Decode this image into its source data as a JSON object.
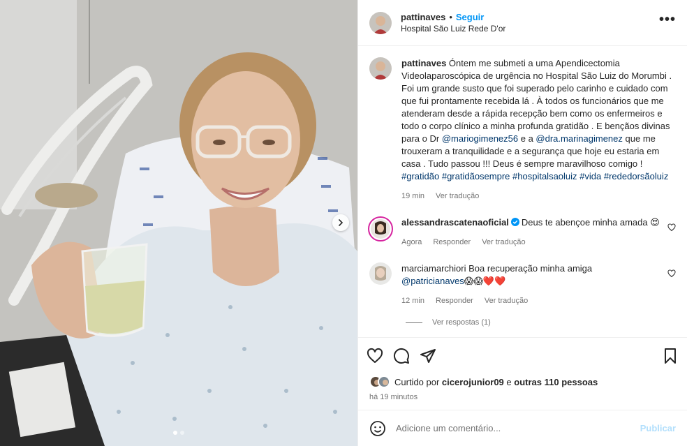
{
  "header": {
    "username": "pattinaves",
    "separator": "•",
    "follow_label": "Seguir",
    "location": "Hospital São Luiz Rede D'or",
    "more_label": "•••"
  },
  "caption": {
    "username": "pattinaves",
    "text_1": " Óntem me submeti a uma Apendicectomia Videolaparoscópica de urgência no Hospital São Luiz do Morumbi . Foi um grande susto que foi superado pelo carinho e cuidado com que fui prontamente recebida lá . À todos os funcionários que me atenderam desde a rápida recepção bem como os enfermeiros e todo o corpo clínico a minha profunda gratidão . E bençãos divinas para o Dr ",
    "mention_1": "@mariogimenez56",
    "text_2": " e a ",
    "mention_2": "@dra.marinagimenez",
    "text_3": " que me trouxeram a tranquilidade e a segurança que hoje eu estaria em casa . Tudo passou !!! Deus é sempre maravilhoso comigo ! ",
    "hashtags": [
      "#gratidão",
      "#gratidãosempre",
      "#hospitalsaoluiz",
      "#vida",
      "#rededorsãoluiz"
    ],
    "time": "19 min",
    "translate": "Ver tradução"
  },
  "comments": [
    {
      "username": "alessandrascatenaoficial",
      "text": "Deus te abençoe minha amada 😍",
      "time": "Agora",
      "reply": "Responder",
      "translate": "Ver tradução"
    },
    {
      "username": "marciamarchiori",
      "text": "Boa recuperação minha amiga",
      "mention": "@patricianaves",
      "emoji": "😱😱❤️❤️",
      "time": "12 min",
      "reply": "Responder",
      "translate": "Ver tradução",
      "replies_label": "Ver respostas (1)"
    }
  ],
  "likes": {
    "prefix": "Curtido por ",
    "user": "cicerojunior09",
    "middle": " e ",
    "others": "outras 110 pessoas"
  },
  "posted_ago": "há 19 minutos",
  "add_comment": {
    "placeholder": "Adicione um comentário...",
    "publish_label": "Publicar"
  },
  "colors": {
    "accent": "#0095f6",
    "link": "#00376b",
    "muted": "#737373",
    "publish_disabled": "#b2dffc"
  },
  "icons": [
    "heart-icon",
    "comment-icon",
    "share-icon",
    "save-icon",
    "emoji-icon",
    "chevron-right-icon",
    "verified-icon"
  ],
  "carousel": {
    "current": 1,
    "total": 2
  }
}
